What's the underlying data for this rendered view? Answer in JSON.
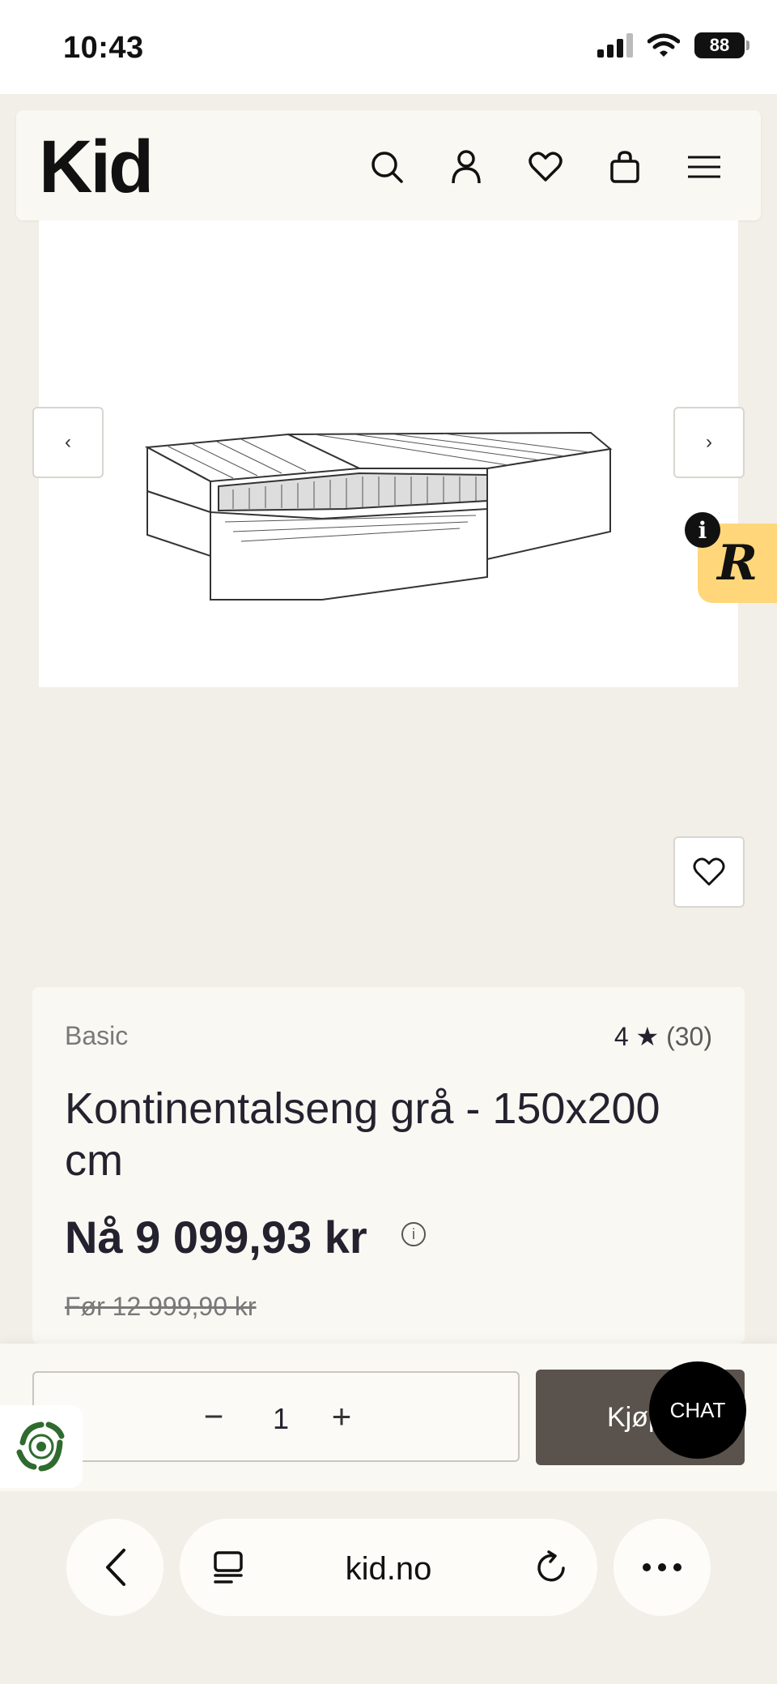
{
  "status_bar": {
    "time": "10:43",
    "battery": "88"
  },
  "header": {
    "logo": "Kid",
    "icons": [
      "search-icon",
      "account-icon",
      "wishlist-icon",
      "cart-icon",
      "menu-icon"
    ]
  },
  "gallery": {
    "prev_label": "‹",
    "next_label": "›"
  },
  "widget": {
    "letter": "R",
    "info": "i"
  },
  "product": {
    "brand": "Basic",
    "rating_value": "4",
    "rating_star": "★",
    "rating_count": "(30)",
    "title": "Kontinentalseng grå - 150x200 cm",
    "price_now": "Nå 9 099,93 kr",
    "price_info": "i",
    "price_before": "Før 12 999,90 kr"
  },
  "purchase": {
    "minus": "−",
    "quantity": "1",
    "plus": "+",
    "buy_label": "Kjøp",
    "chat_label": "CHAT"
  },
  "browser": {
    "url": "kid.no"
  },
  "colors": {
    "page_bg": "#f2efe8",
    "card_bg": "#faf8f3",
    "buy_button": "#5a524c",
    "widget": "#ffd77a",
    "text": "#23222e"
  }
}
